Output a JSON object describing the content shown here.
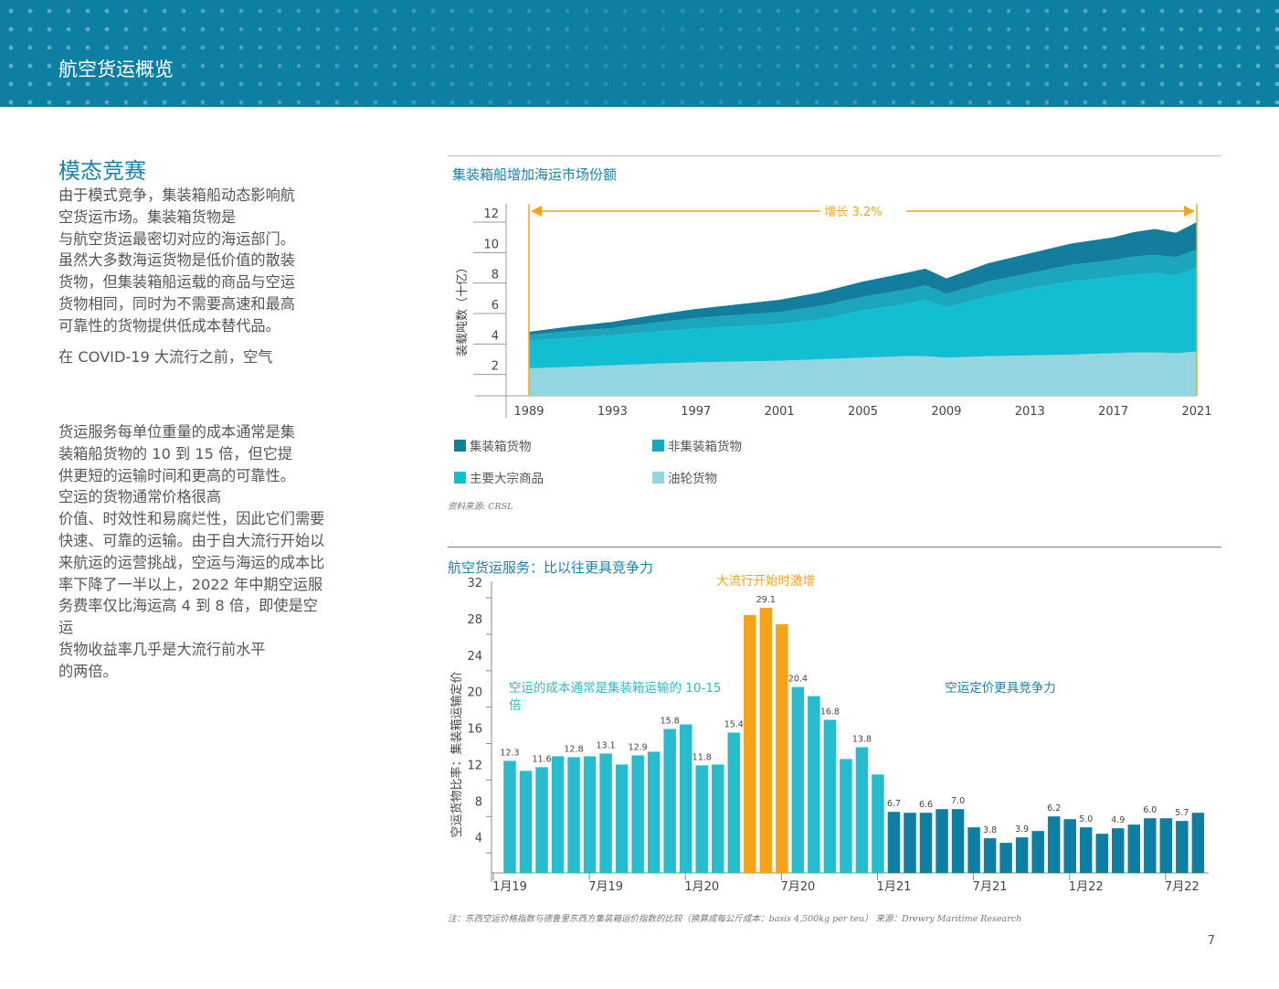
{
  "header": {
    "title": "航空货运概览"
  },
  "section": {
    "title": "模态竞赛",
    "para1": [
      "由于模式竞争，集装箱船动态影响航",
      "空货运市场。集装箱货物是",
      "与航空货运最密切对应的海运部门。",
      "虽然大多数海运货物是低价值的散装",
      "货物，但集装箱船运载的商品与空运",
      "货物相同，同时为不需要高速和最高",
      "可靠性的货物提供低成本替代品。"
    ],
    "para2": [
      "在 COVID-19 大流行之前，空气"
    ],
    "para3": [
      "货运服务每单位重量的成本通常是集",
      "装箱船货物的 10 到 15 倍，但它提",
      "供更短的运输时间和更高的可靠性。",
      "空运的货物通常价格很高",
      "价值、时效性和易腐烂性，因此它们需要",
      "快速、可靠的运输。由于自大流行开始以",
      "来航运的运营挑战，空运与海运的成本比",
      "率下降了一半以上，2022 年中期空运服",
      "务费率仅比海运高 4 到 8 倍，即使是空",
      "运",
      "货物收益率几乎是大流行前水平",
      "的两倍。"
    ]
  },
  "chart1": {
    "title": "集装箱船增加海运市场份额",
    "source": "资料来源: CRSL",
    "growth_label": "增长 3.2%",
    "legend": [
      "集装箱货物",
      "非集装箱货物",
      "主要大宗商品",
      "油轮货物"
    ],
    "legend_colors": [
      "#137d9e",
      "#1aa7bd",
      "#12bed2",
      "#93d6e0"
    ]
  },
  "chart2": {
    "title": "航空货运服务：比以往更具竞争力",
    "annotation_surge": "大流行开始时激增",
    "annotation_left": [
      "空运的成本通常是集装箱运输的 10-15",
      "倍"
    ],
    "annotation_right": "空运定价更具竞争力",
    "note": "注：东西空运价格指数与德鲁里东西方集装箱运价指数的比较（换算成每公斤成本：basis 4,500kg per teu） 来源：Drewry Maritime Research"
  },
  "page_number": "7",
  "chart_data": [
    {
      "type": "area",
      "title": "集装箱船增加海运市场份额",
      "ylabel": "装载吨数（十亿）",
      "xlabel": "",
      "x_ticks": [
        "1989",
        "1993",
        "1997",
        "2001",
        "2005",
        "2009",
        "2013",
        "2017",
        "2021"
      ],
      "y_ticks": [
        "12",
        "10",
        "8",
        "6",
        "4",
        "2"
      ],
      "ylim": [
        0,
        12
      ],
      "xlim": [
        1989,
        2021
      ],
      "stacked": true,
      "x": [
        1989,
        1991,
        1993,
        1995,
        1997,
        1999,
        2001,
        2003,
        2005,
        2007,
        2008,
        2009,
        2011,
        2013,
        2015,
        2016,
        2017,
        2018,
        2019,
        2020,
        2021
      ],
      "series": [
        {
          "name": "油轮货物",
          "values": [
            1.8,
            1.9,
            2.0,
            2.1,
            2.2,
            2.25,
            2.3,
            2.4,
            2.5,
            2.6,
            2.6,
            2.5,
            2.6,
            2.65,
            2.7,
            2.75,
            2.8,
            2.85,
            2.85,
            2.8,
            2.9
          ]
        },
        {
          "name": "主要大宗商品",
          "values": [
            1.8,
            1.9,
            1.95,
            2.1,
            2.2,
            2.3,
            2.4,
            2.6,
            3.1,
            3.4,
            3.7,
            3.3,
            3.9,
            4.4,
            4.8,
            4.9,
            5.0,
            5.1,
            5.2,
            5.1,
            5.5
          ]
        },
        {
          "name": "非集装箱货物",
          "values": [
            0.4,
            0.45,
            0.5,
            0.6,
            0.7,
            0.75,
            0.8,
            0.9,
            0.9,
            0.95,
            0.95,
            0.9,
            1.0,
            1.0,
            1.1,
            1.1,
            1.1,
            1.2,
            1.2,
            1.2,
            1.2
          ]
        },
        {
          "name": "集装箱货物",
          "values": [
            0.2,
            0.3,
            0.4,
            0.5,
            0.6,
            0.7,
            0.8,
            0.9,
            1.0,
            1.1,
            1.1,
            1.0,
            1.2,
            1.3,
            1.4,
            1.45,
            1.5,
            1.6,
            1.7,
            1.6,
            1.8
          ]
        }
      ]
    },
    {
      "type": "bar",
      "title": "航空货运服务：比以往更具竞争力",
      "ylabel": "空运货物比率：集装箱运输定价",
      "xlabel": "",
      "y_ticks": [
        "32",
        "28",
        "24",
        "20",
        "16",
        "12",
        "8",
        "4"
      ],
      "ylim": [
        0,
        32
      ],
      "x_ticks": [
        "1月19",
        "7月19",
        "1月20",
        "7月20",
        "1月21",
        "7月21",
        "1月22",
        "7月22"
      ],
      "values": [
        12.3,
        11.2,
        11.6,
        12.8,
        12.7,
        12.8,
        13.1,
        11.9,
        12.9,
        13.3,
        15.8,
        16.3,
        11.8,
        11.9,
        15.4,
        28.3,
        29.1,
        27.3,
        20.4,
        19.4,
        16.8,
        12.5,
        13.8,
        10.8,
        6.7,
        6.6,
        6.6,
        7.0,
        7.0,
        5.0,
        3.8,
        3.3,
        3.9,
        4.6,
        6.2,
        5.9,
        5.0,
        4.3,
        4.9,
        5.3,
        6.0,
        6.0,
        5.7,
        6.6
      ],
      "value_labels": [
        [
          0,
          "12.3"
        ],
        [
          2,
          "11.6"
        ],
        [
          4,
          "12.8"
        ],
        [
          6,
          "13.1"
        ],
        [
          8,
          "12.9"
        ],
        [
          10,
          "15.8"
        ],
        [
          12,
          "11.8"
        ],
        [
          14,
          "15.4"
        ],
        [
          16,
          "29.1"
        ],
        [
          18,
          "20.4"
        ],
        [
          20,
          "16.8"
        ],
        [
          22,
          "13.8"
        ],
        [
          24,
          "6.7"
        ],
        [
          26,
          "6.6"
        ],
        [
          28,
          "7.0"
        ],
        [
          30,
          "3.8"
        ],
        [
          32,
          "3.9"
        ],
        [
          34,
          "6.2"
        ],
        [
          36,
          "5.0"
        ],
        [
          38,
          "4.9"
        ],
        [
          40,
          "6.0"
        ],
        [
          42,
          "5.7"
        ]
      ],
      "colors": {
        "pre": "#27bccd",
        "surge": "#f7a21b",
        "post": "#0e7fa3"
      }
    }
  ]
}
